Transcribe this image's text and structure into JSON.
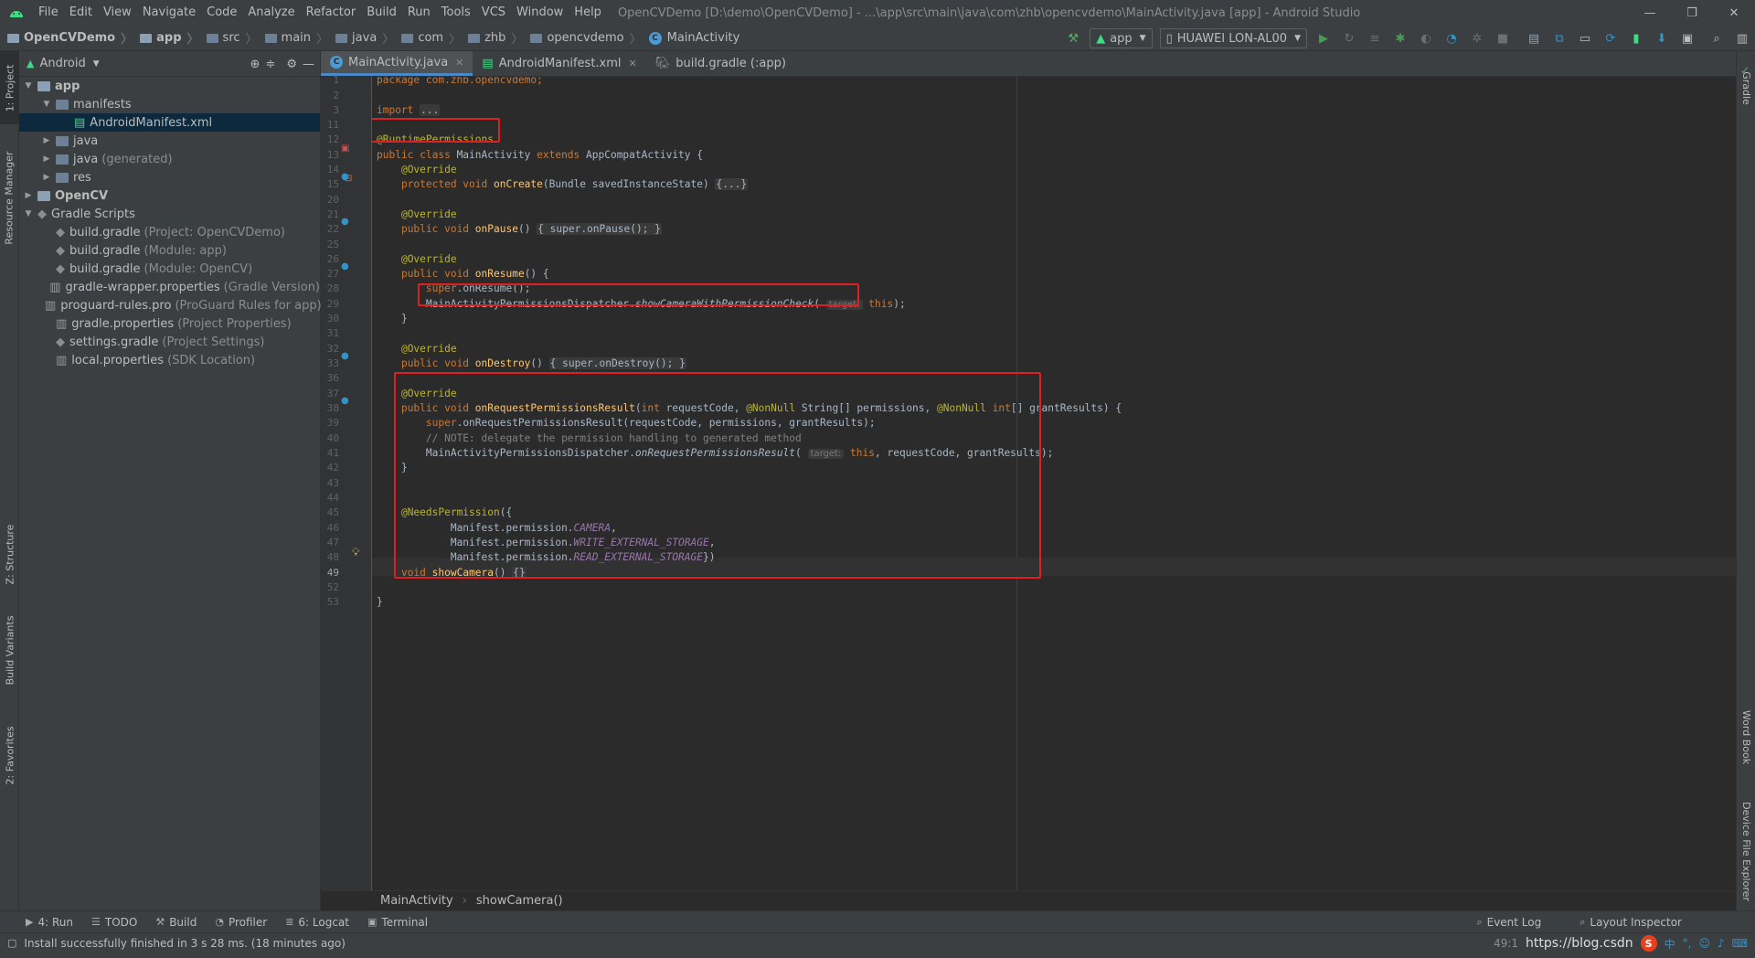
{
  "window": {
    "title": "OpenCVDemo [D:\\demo\\OpenCVDemo] - ...\\app\\src\\main\\java\\com\\zhb\\opencvdemo\\MainActivity.java [app] - Android Studio",
    "menu": [
      "File",
      "Edit",
      "View",
      "Navigate",
      "Code",
      "Analyze",
      "Refactor",
      "Build",
      "Run",
      "Tools",
      "VCS",
      "Window",
      "Help"
    ]
  },
  "breadcrumbs": [
    "OpenCVDemo",
    "app",
    "src",
    "main",
    "java",
    "com",
    "zhb",
    "opencvdemo",
    "MainActivity"
  ],
  "toolbar": {
    "run_config": "app",
    "device": "HUAWEI LON-AL00"
  },
  "left_strip": {
    "project_tab": "1: Project",
    "resource_manager_tab": "Resource Manager",
    "structure_tab": "Z: Structure",
    "build_variants_tab": "Build Variants",
    "favorites_tab": "2: Favorites"
  },
  "right_strip": {
    "gradle_tab": "Gradle",
    "word_book_tab": "Word Book",
    "device_file_explorer_tab": "Device File Explorer"
  },
  "project_panel": {
    "view_mode": "Android",
    "tree": [
      {
        "label": "app",
        "suffix": "",
        "bold": true
      },
      {
        "label": "manifests",
        "suffix": ""
      },
      {
        "label": "AndroidManifest.xml",
        "suffix": "",
        "selected": true
      },
      {
        "label": "java",
        "suffix": ""
      },
      {
        "label": "java",
        "suffix": "(generated)"
      },
      {
        "label": "res",
        "suffix": ""
      },
      {
        "label": "OpenCV",
        "suffix": "",
        "bold": true
      },
      {
        "label": "Gradle Scripts",
        "suffix": ""
      },
      {
        "label": "build.gradle",
        "suffix": "(Project: OpenCVDemo)"
      },
      {
        "label": "build.gradle",
        "suffix": "(Module: app)"
      },
      {
        "label": "build.gradle",
        "suffix": "(Module: OpenCV)"
      },
      {
        "label": "gradle-wrapper.properties",
        "suffix": "(Gradle Version)"
      },
      {
        "label": "proguard-rules.pro",
        "suffix": "(ProGuard Rules for app)"
      },
      {
        "label": "gradle.properties",
        "suffix": "(Project Properties)"
      },
      {
        "label": "settings.gradle",
        "suffix": "(Project Settings)"
      },
      {
        "label": "local.properties",
        "suffix": "(SDK Location)"
      }
    ]
  },
  "editor_tabs": [
    {
      "label": "MainActivity.java",
      "active": true
    },
    {
      "label": "AndroidManifest.xml",
      "active": false
    },
    {
      "label": "build.gradle (:app)",
      "active": false
    }
  ],
  "line_numbers": [
    "1",
    "2",
    "3",
    "11",
    "12",
    "13",
    "14",
    "15",
    "20",
    "21",
    "22",
    "25",
    "26",
    "27",
    "28",
    "29",
    "30",
    "31",
    "32",
    "33",
    "36",
    "37",
    "38",
    "39",
    "40",
    "41",
    "42",
    "43",
    "44",
    "45",
    "46",
    "47",
    "48",
    "49",
    "52",
    "53"
  ],
  "code": {
    "l1": "package com.zhb.opencvdemo;",
    "l3_kw": "import",
    "l3_fold": "...",
    "l12": "@RuntimePermissions",
    "l13_a": "public class",
    "l13_b": " MainActivity ",
    "l13_c": "extends",
    "l13_d": " AppCompatActivity {",
    "override": "@Override",
    "l15_kw": "protected void",
    "l15_fn": "onCreate",
    "l15_rest": "(Bundle savedInstanceState) ",
    "l15_fold": "{...}",
    "l22_kw": "public void",
    "l22_fn": "onPause",
    "l22_fold": "{ super.onPause(); }",
    "l27_fn": "onResume",
    "l28": "super.onResume();",
    "l29_a": "MainActivityPermissionsDispatcher.",
    "l29_b": "showCameraWithPermissionCheck",
    "hint_target": "target:",
    "this_kw": "this",
    "l33_fn": "onDestroy",
    "l33_fold": "{ super.onDestroy(); }",
    "l38_fn": "onRequestPermissionsResult",
    "l38_rest_a": "(",
    "l38_int": "int",
    "l38_rest_b": " requestCode, ",
    "nonnull": "@NonNull",
    "l38_rest_c": " String[] permissions, ",
    "l38_rest_d": "[] grantResults) {",
    "l39": ".onRequestPermissionsResult(requestCode, permissions, grantResults);",
    "super_kw": "super",
    "l40": "// NOTE: delegate the permission handling to generated method",
    "l41_b": "onRequestPermissionsResult",
    "l41_rest": ", requestCode, grantResults);",
    "l45": "@NeedsPermission",
    "l46_a": "Manifest.permission.",
    "l46_b": "CAMERA",
    "l47_b": "WRITE_EXTERNAL_STORAGE",
    "l48_b": "READ_EXTERNAL_STORAGE",
    "l49_kw": "void",
    "l49_fn": "showCamera",
    "l49_fold": "{}"
  },
  "editor_breadcrumb": [
    "MainActivity",
    "showCamera()"
  ],
  "bottom_tabs": {
    "run": "4: Run",
    "todo": "TODO",
    "build": "Build",
    "profiler": "Profiler",
    "logcat": "6: Logcat",
    "terminal": "Terminal",
    "event_log": "Event Log",
    "layout_inspector": "Layout Inspector"
  },
  "status": {
    "message": "Install successfully finished in 3 s 28 ms. (18 minutes ago)",
    "position": "49:1",
    "watermark": "https://blog.csdn",
    "ime": "中"
  },
  "colors": {
    "highlight_box": "#e02020",
    "keyword": "#cc7832",
    "annotation": "#bbb529",
    "method": "#ffc66d",
    "static_field": "#9876aa"
  }
}
